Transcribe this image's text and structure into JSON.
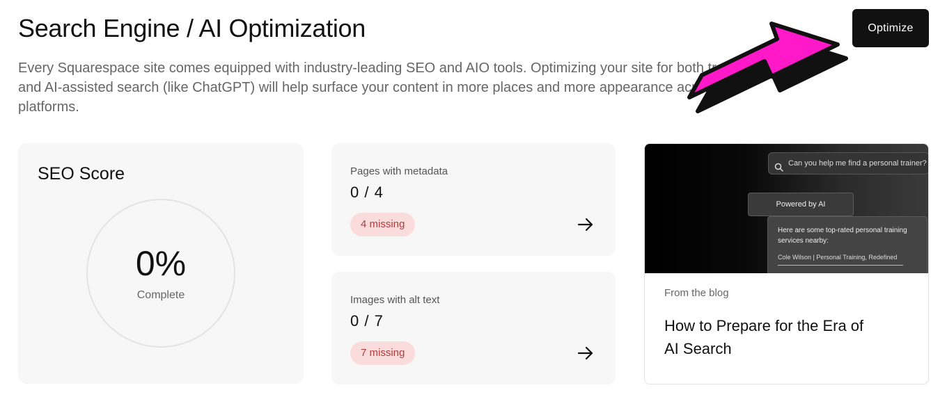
{
  "header": {
    "title": "Search Engine / AI Optimization",
    "optimize_label": "Optimize",
    "intro": "Every Squarespace site comes equipped with industry-leading SEO and AIO tools. Optimizing your site for both traditional and AI-assisted search (like ChatGPT) will help surface your content in more places and more appearance across platforms."
  },
  "seo_score": {
    "title": "SEO Score",
    "value": "0%",
    "label": "Complete",
    "percent_complete": 0
  },
  "metrics": [
    {
      "label": "Pages with metadata",
      "value": "0 / 4",
      "badge": "4 missing"
    },
    {
      "label": "Images with alt text",
      "value": "0 / 7",
      "badge": "7 missing"
    }
  ],
  "blog": {
    "eyebrow": "From the blog",
    "title": "How to Prepare for the Era of AI Search",
    "visual": {
      "query": "Can you help me find a personal trainer?",
      "powered": "Powered by AI",
      "answer": "Here are some top-rated personal training services nearby:",
      "result": "Cole Wilson | Personal Training, Redefined"
    }
  },
  "colors": {
    "accent_arrow": "#ff19c8",
    "button_bg": "#111111",
    "badge_bg": "#fbdcdc",
    "badge_text": "#b23a3a",
    "card_bg": "#f7f7f7"
  },
  "icons": {
    "metric_arrow": "arrow-right-icon",
    "query": "search-icon",
    "annotation": "pink-pointer-arrow"
  }
}
